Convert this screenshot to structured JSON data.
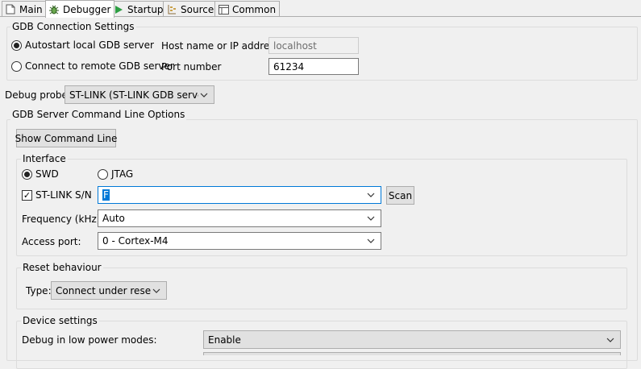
{
  "tabs": [
    {
      "label": "Main",
      "icon": "main-icon"
    },
    {
      "label": "Debugger",
      "icon": "debugger-icon"
    },
    {
      "label": "Startup",
      "icon": "startup-icon"
    },
    {
      "label": "Source",
      "icon": "source-icon"
    },
    {
      "label": "Common",
      "icon": "common-icon"
    }
  ],
  "gdb_connection": {
    "title": "GDB Connection Settings",
    "autostart_label": "Autostart local GDB server",
    "remote_label": "Connect to remote GDB server",
    "hostname_label": "Host name or IP address",
    "hostname_value": "localhost",
    "port_label": "Port number",
    "port_value": "61234"
  },
  "debug_probe": {
    "label": "Debug probe",
    "value": "ST-LINK (ST-LINK GDB server)"
  },
  "server_options": {
    "title": "GDB Server Command Line Options",
    "show_cmd_button": "Show Command Line"
  },
  "interface": {
    "title": "Interface",
    "swd_label": "SWD",
    "jtag_label": "JTAG",
    "stlink_sn_label": "ST-LINK S/N",
    "stlink_sn_value": "F",
    "scan_button": "Scan",
    "frequency_label": "Frequency (kHz):",
    "frequency_value": "Auto",
    "access_port_label": "Access port:",
    "access_port_value": "0 - Cortex-M4"
  },
  "reset": {
    "title": "Reset behaviour",
    "type_label": "Type:",
    "type_value": "Connect under reset"
  },
  "device": {
    "title": "Device settings",
    "low_power_label": "Debug in low power modes:",
    "low_power_value": "Enable"
  },
  "colors": {
    "accent": "#0078d7",
    "background": "#f0f0f0"
  }
}
